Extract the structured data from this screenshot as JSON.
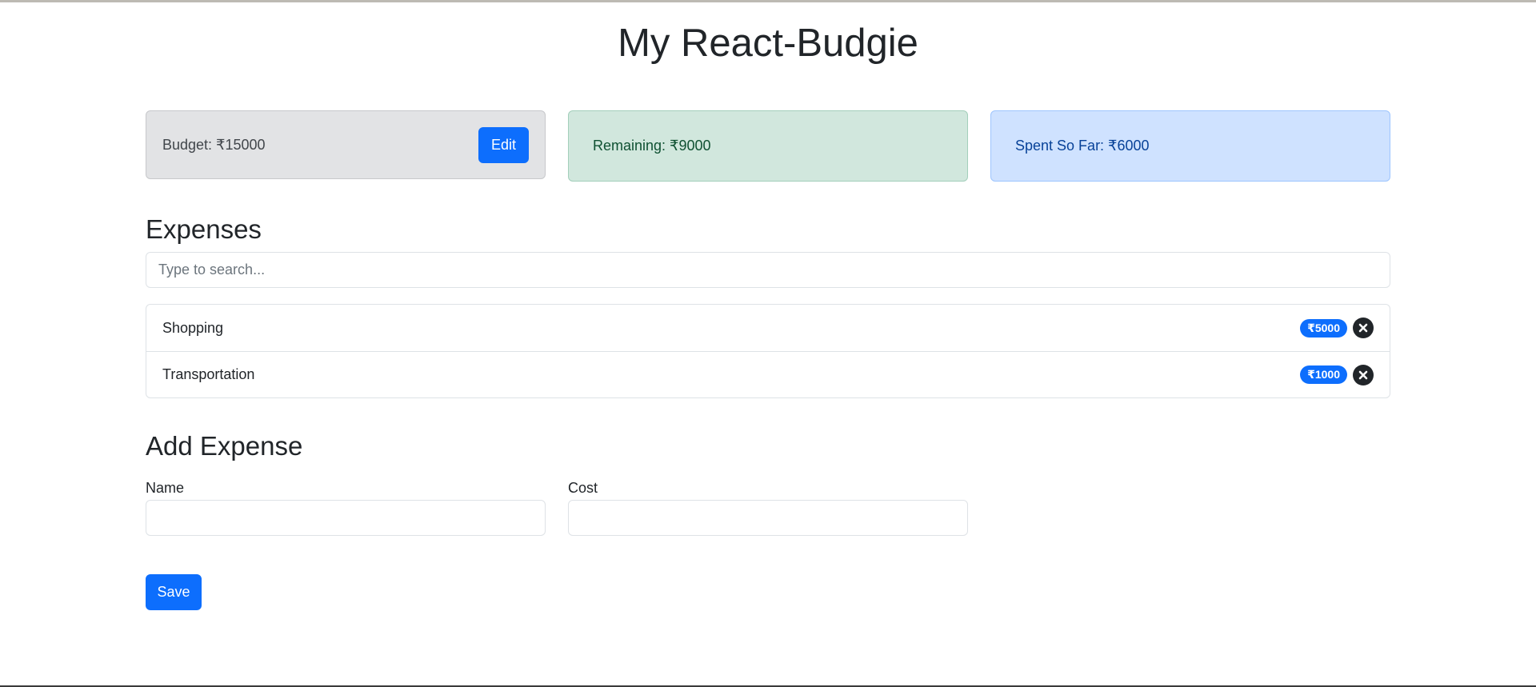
{
  "app": {
    "title": "My React-Budgie"
  },
  "summary": {
    "budget_text": "Budget: ₹15000",
    "edit_label": "Edit",
    "remaining_text": "Remaining: ₹9000",
    "spent_text": "Spent So Far: ₹6000"
  },
  "expenses": {
    "heading": "Expenses",
    "search_placeholder": "Type to search...",
    "items": [
      {
        "name": "Shopping",
        "cost": "₹5000"
      },
      {
        "name": "Transportation",
        "cost": "₹1000"
      }
    ]
  },
  "add_expense": {
    "heading": "Add Expense",
    "name_label": "Name",
    "cost_label": "Cost",
    "name_value": "",
    "cost_value": "",
    "save_label": "Save"
  },
  "icons": {
    "delete": "close-circle-icon"
  },
  "colors": {
    "primary": "#0d6efd",
    "budget_bg": "#e2e3e5",
    "remaining_bg": "#d1e7dd",
    "spent_bg": "#cfe2ff",
    "text": "#212529"
  }
}
